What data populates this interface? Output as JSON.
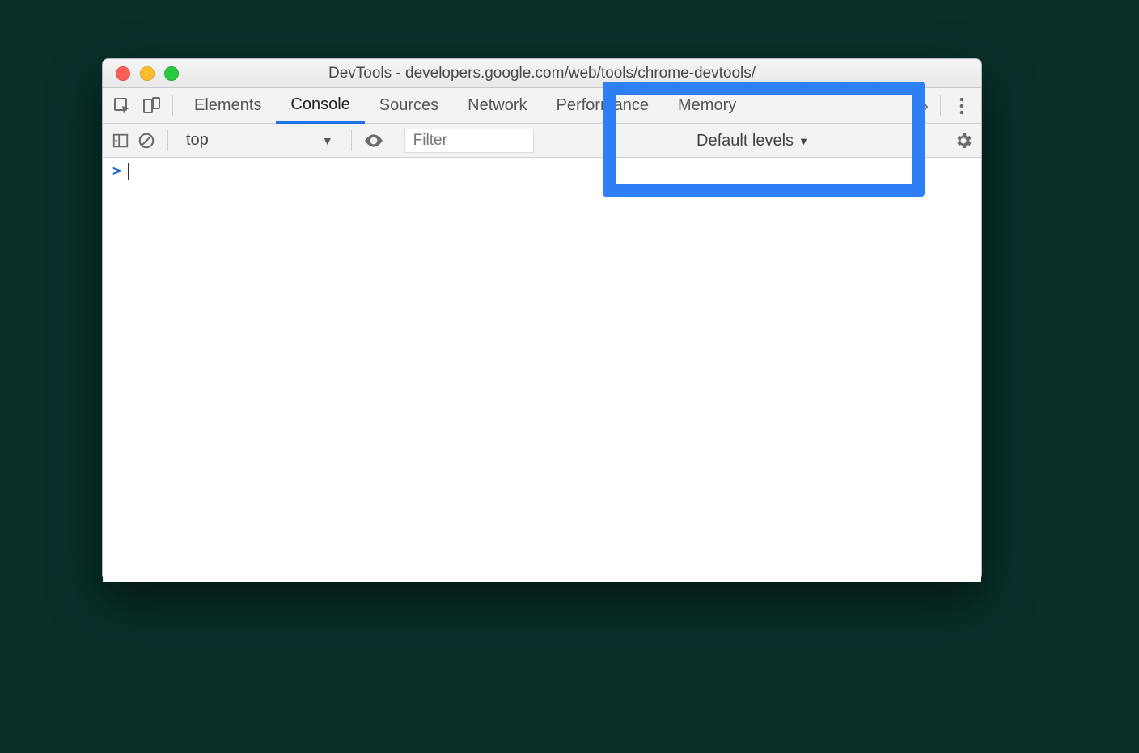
{
  "window": {
    "title": "DevTools - developers.google.com/web/tools/chrome-devtools/"
  },
  "tabs": {
    "items": [
      "Elements",
      "Console",
      "Sources",
      "Network",
      "Performance",
      "Memory"
    ],
    "active_index": 1
  },
  "console_toolbar": {
    "context": "top",
    "filter_placeholder": "Filter",
    "levels_label": "Default levels"
  },
  "prompt": {
    "chevron": ">"
  }
}
